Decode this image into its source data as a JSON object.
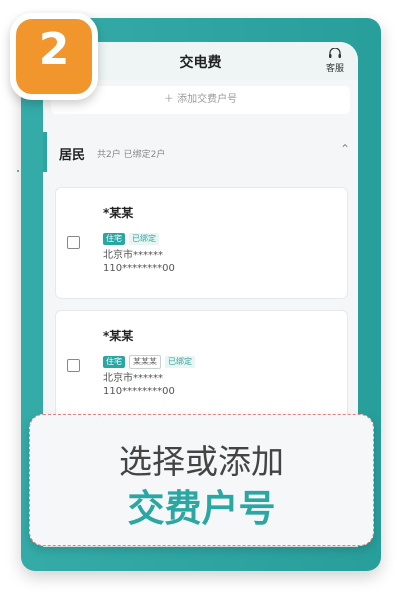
{
  "step_badge": "2",
  "header": {
    "title": "交电费",
    "service_label": "客服"
  },
  "add_account": {
    "label": "＋ 添加交费户号"
  },
  "section": {
    "title": "居民",
    "subtitle": "共2户  已绑定2户",
    "chevron": "⌃"
  },
  "accounts": [
    {
      "name": "*某某",
      "tags": [
        "住宅",
        "已绑定"
      ],
      "city": "北京市******",
      "account": "110********00"
    },
    {
      "name": "*某某",
      "tags": [
        "住宅",
        "某某某",
        "已绑定"
      ],
      "city": "北京市******",
      "account": "110********00"
    }
  ],
  "callout": {
    "line1": "选择或添加",
    "line2": "交费户号"
  },
  "colors": {
    "accent": "#2aa7a3",
    "badge": "#f1962d",
    "callout_border": "#e08282"
  }
}
